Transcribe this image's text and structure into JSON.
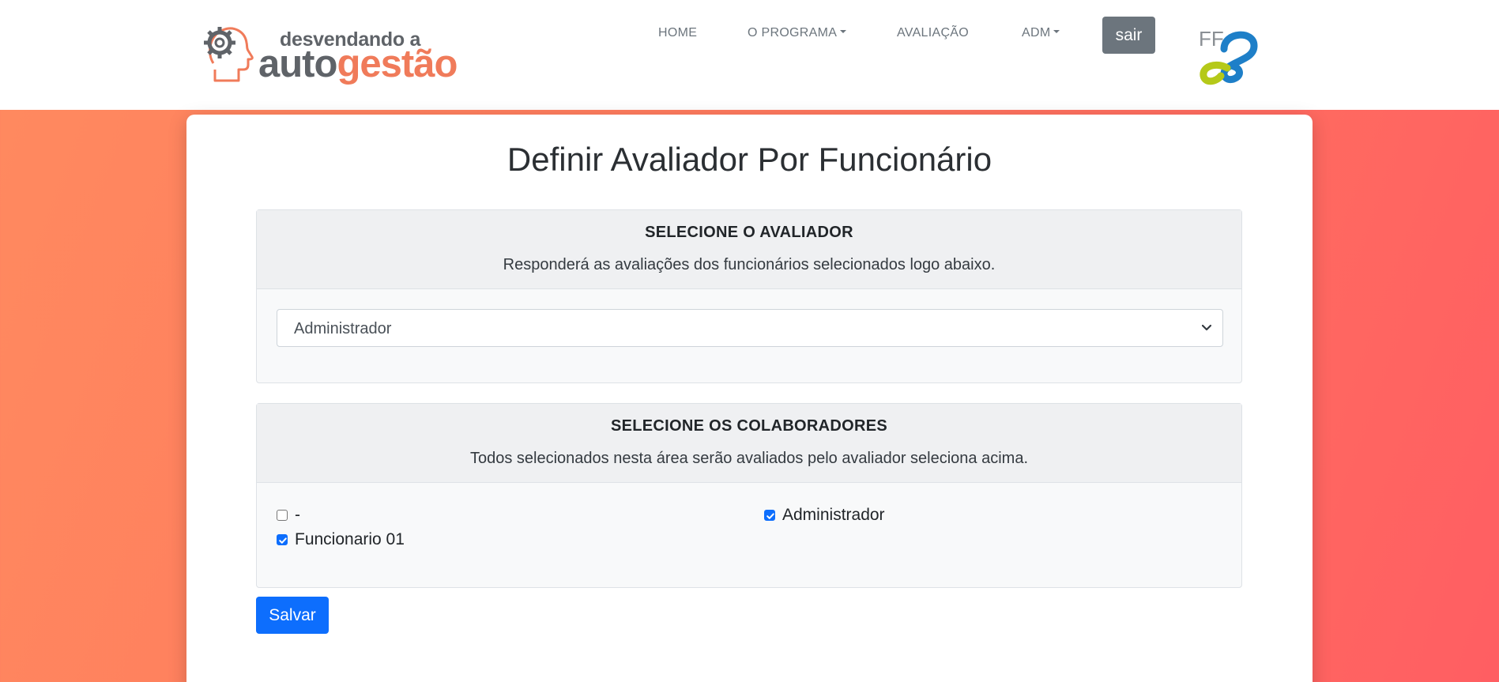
{
  "header": {
    "logo": {
      "line1": "desvendando a",
      "line2_part1": "auto",
      "line2_part2": "gestão"
    },
    "nav": {
      "home": "HOME",
      "programa": "O PROGRAMA",
      "avaliacao": "AVALIAÇÃO",
      "adm": "ADM"
    },
    "logout_label": "sair",
    "partner_logo_text": "FF"
  },
  "page": {
    "title": "Definir Avaliador Por Funcionário"
  },
  "avaliador_panel": {
    "title": "SELECIONE O AVALIADOR",
    "subtitle": "Responderá as avaliações dos funcionários selecionados logo abaixo.",
    "selected": "Administrador"
  },
  "colaboradores_panel": {
    "title": "SELECIONE OS COLABORADORES",
    "subtitle": "Todos selecionados nesta área serão avaliados pelo avaliador seleciona acima.",
    "items": [
      {
        "label": "-",
        "checked": false
      },
      {
        "label": "Administrador",
        "checked": true
      },
      {
        "label": "Funcionario 01",
        "checked": true
      }
    ]
  },
  "actions": {
    "save_label": "Salvar"
  },
  "colors": {
    "primary": "#0d6efd",
    "secondary": "#6c757d",
    "brand_orange": "#f07b5a",
    "brand_gray": "#5f6368"
  }
}
